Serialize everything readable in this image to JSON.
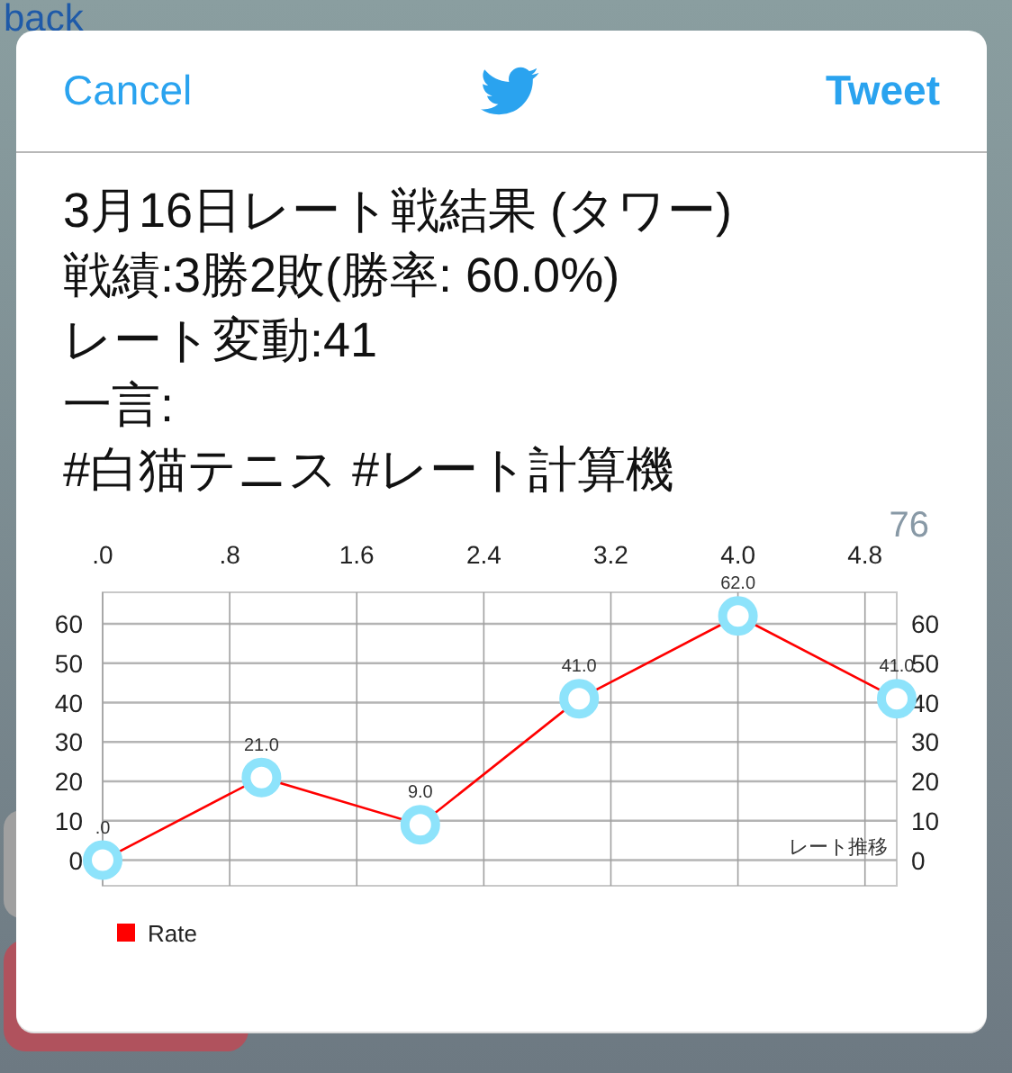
{
  "back_link": "back",
  "header": {
    "cancel": "Cancel",
    "tweet": "Tweet"
  },
  "tweet_text": [
    "3月16日レート戦結果 (タワー)",
    "戦績:3勝2敗(勝率: 60.0%)",
    "レート変動:41",
    "一言:",
    "#白猫テニス #レート計算機"
  ],
  "char_count": "76",
  "chart": {
    "caption": "レート推移",
    "chart_data": {
      "type": "line",
      "x": [
        0,
        1,
        2,
        3,
        4,
        5
      ],
      "series": [
        {
          "name": "Rate",
          "color": "#ff0000",
          "marker": "circle",
          "values": [
            0,
            21,
            9,
            41,
            62,
            41
          ]
        }
      ],
      "grid": true,
      "value_labels": [
        ".0",
        "21.0",
        "9.0",
        "41.0",
        "62.0",
        "41.0"
      ],
      "xlim": [
        0,
        5
      ],
      "ylim": [
        -6.5,
        68
      ],
      "xticks": [
        {
          "value": 0,
          "label": ".0"
        },
        {
          "value": 0.8,
          "label": ".8"
        },
        {
          "value": 1.6,
          "label": "1.6"
        },
        {
          "value": 2.4,
          "label": "2.4"
        },
        {
          "value": 3.2,
          "label": "3.2"
        },
        {
          "value": 4.0,
          "label": "4.0"
        },
        {
          "value": 4.8,
          "label": "4.8"
        }
      ],
      "yticks": [
        {
          "value": 0,
          "label": "0"
        },
        {
          "value": 10,
          "label": "10"
        },
        {
          "value": 20,
          "label": "20"
        },
        {
          "value": 30,
          "label": "30"
        },
        {
          "value": 40,
          "label": "40"
        },
        {
          "value": 50,
          "label": "50"
        },
        {
          "value": 60,
          "label": "60"
        }
      ],
      "y2lim": [
        -6.5,
        68
      ],
      "y2ticks": [
        {
          "value": 0,
          "label": "0"
        },
        {
          "value": 10,
          "label": "10"
        },
        {
          "value": 20,
          "label": "20"
        },
        {
          "value": 30,
          "label": "30"
        },
        {
          "value": 40,
          "label": "40"
        },
        {
          "value": 50,
          "label": "50"
        },
        {
          "value": 60,
          "label": "60"
        }
      ]
    }
  }
}
